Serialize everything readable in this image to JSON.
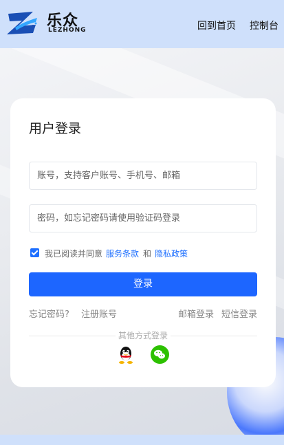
{
  "header": {
    "logo_text_cn": "乐众",
    "logo_text_en": "LEZHONG",
    "nav": [
      {
        "label": "回到首页"
      },
      {
        "label": "控制台"
      }
    ]
  },
  "login": {
    "title": "用户登录",
    "account_placeholder": "账号，支持客户账号、手机号、邮箱",
    "password_placeholder": "密码，如忘记密码请使用验证码登录",
    "agree_checked": true,
    "agree_prefix": "我已阅读并同意",
    "terms_label": "服务条款",
    "agree_and": "和",
    "privacy_label": "隐私政策",
    "submit_label": "登录",
    "forgot_label": "忘记密码?",
    "register_label": "注册账号",
    "email_login_label": "邮箱登录",
    "sms_login_label": "短信登录",
    "other_methods_label": "其他方式登录",
    "other_methods": [
      {
        "icon": "qq-icon"
      },
      {
        "icon": "wechat-icon"
      }
    ]
  },
  "colors": {
    "primary": "#1d66ff",
    "header_bg": "#cfe0fb",
    "wechat_green": "#2dc100"
  }
}
